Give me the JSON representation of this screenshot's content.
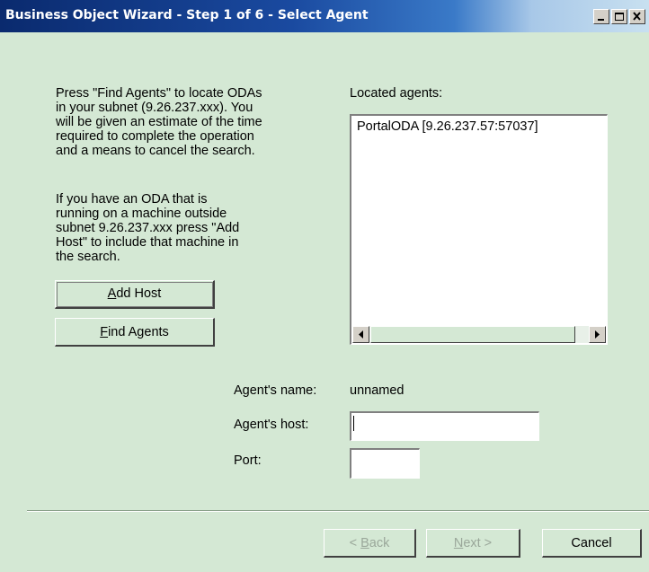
{
  "window": {
    "title": "Business Object Wizard - Step 1 of 6 - Select Agent"
  },
  "left": {
    "para1": "Press \"Find Agents\" to locate ODAs\nin your subnet (9.26.237.xxx). You\nwill be given an estimate of the time\nrequired to complete the operation\nand a means to cancel the search.",
    "para2": "If you have an ODA that is\nrunning on a machine outside\nsubnet 9.26.237.xxx press \"Add\nHost\" to include that machine in\nthe search.",
    "add_host": {
      "mnemonic": "A",
      "rest": "dd Host"
    },
    "find_agents": {
      "mnemonic": "F",
      "rest": "ind Agents"
    }
  },
  "located": {
    "label": "Located agents:",
    "items": [
      "PortalODA [9.26.237.57:57037]"
    ]
  },
  "form": {
    "name_label": "Agent's name:",
    "name_value": "unnamed",
    "host_label": "Agent's host:",
    "host_value": "",
    "port_label": "Port:",
    "port_value": ""
  },
  "buttons": {
    "back": {
      "prefix": "< ",
      "mnemonic": "B",
      "rest": "ack"
    },
    "next": {
      "mnemonic": "N",
      "rest": "ext >"
    },
    "cancel": "Cancel"
  }
}
